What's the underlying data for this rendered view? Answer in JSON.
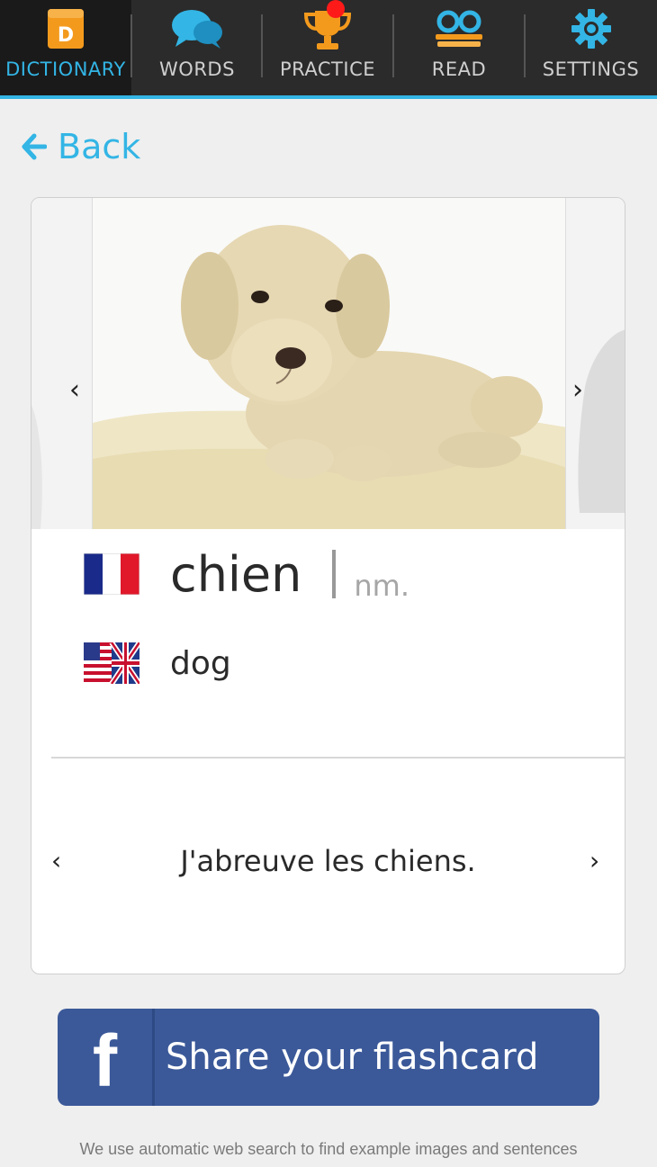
{
  "nav": {
    "tabs": [
      {
        "label": "DICTIONARY",
        "icon": "dictionary-book-icon",
        "icon_text": "D"
      },
      {
        "label": "WORDS",
        "icon": "speech-bubbles-icon"
      },
      {
        "label": "PRACTICE",
        "icon": "trophy-icon"
      },
      {
        "label": "READ",
        "icon": "reading-glasses-icon"
      },
      {
        "label": "SETTINGS",
        "icon": "gear-icon"
      }
    ],
    "active_tab": "DICTIONARY",
    "accent_color": "#33b5e5",
    "badge_color": "#ff1a1a"
  },
  "back": {
    "label": "Back"
  },
  "flashcard": {
    "image_prev": "‹",
    "image_next": "›",
    "foreign_word": "chien",
    "part_of_speech": "nm.",
    "translation": "dog",
    "foreign_flag": "france-flag-icon",
    "native_flag": "us-uk-flag-icon",
    "sentence": "J'abreuve les chiens.",
    "sentence_prev": "‹",
    "sentence_next": "›"
  },
  "share": {
    "label": "Share your flashcard",
    "icon": "facebook-icon",
    "icon_text": "f",
    "color": "#3b5999"
  },
  "footnote": "We use automatic web search to find example images and sentences"
}
